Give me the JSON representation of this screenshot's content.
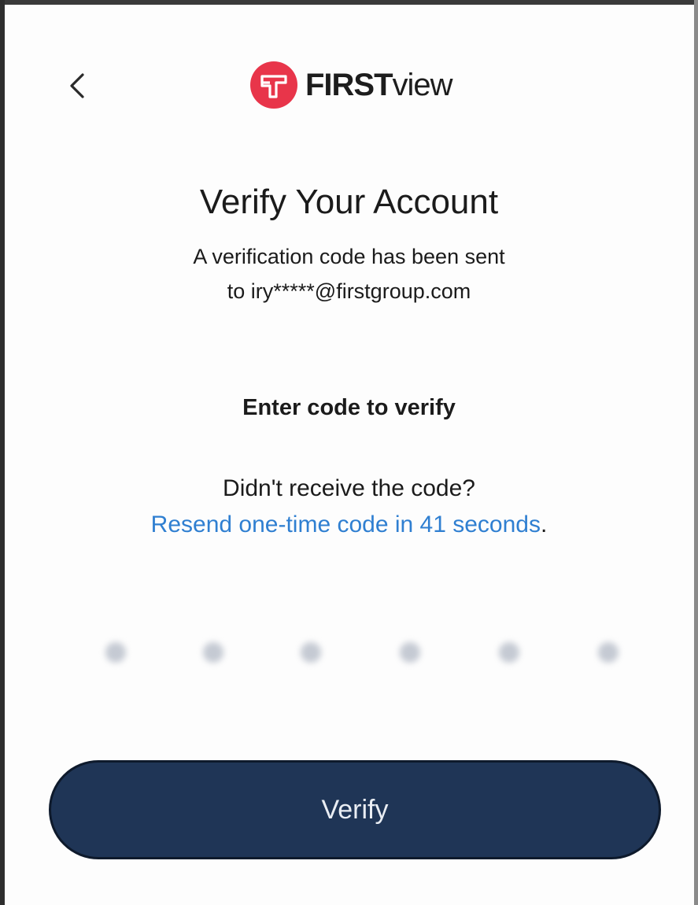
{
  "header": {
    "back_icon": "chevron-left-icon",
    "logo": {
      "brand_bold": "FIRST",
      "brand_light": "view",
      "mark_color": "#e8354a"
    }
  },
  "main": {
    "title": "Verify Your Account",
    "subtitle_line1": "A verification code has been sent",
    "subtitle_line2": "to iry*****@firstgroup.com",
    "enter_code_label": "Enter code to verify",
    "didnt_receive": "Didn't receive the code?",
    "resend_link": "Resend one-time code in 41 seconds",
    "resend_suffix": ".",
    "code_length": 6
  },
  "footer": {
    "verify_label": "Verify"
  },
  "colors": {
    "link": "#2f7fd1",
    "button_bg": "#1f3556",
    "button_text": "#e9edf3"
  }
}
